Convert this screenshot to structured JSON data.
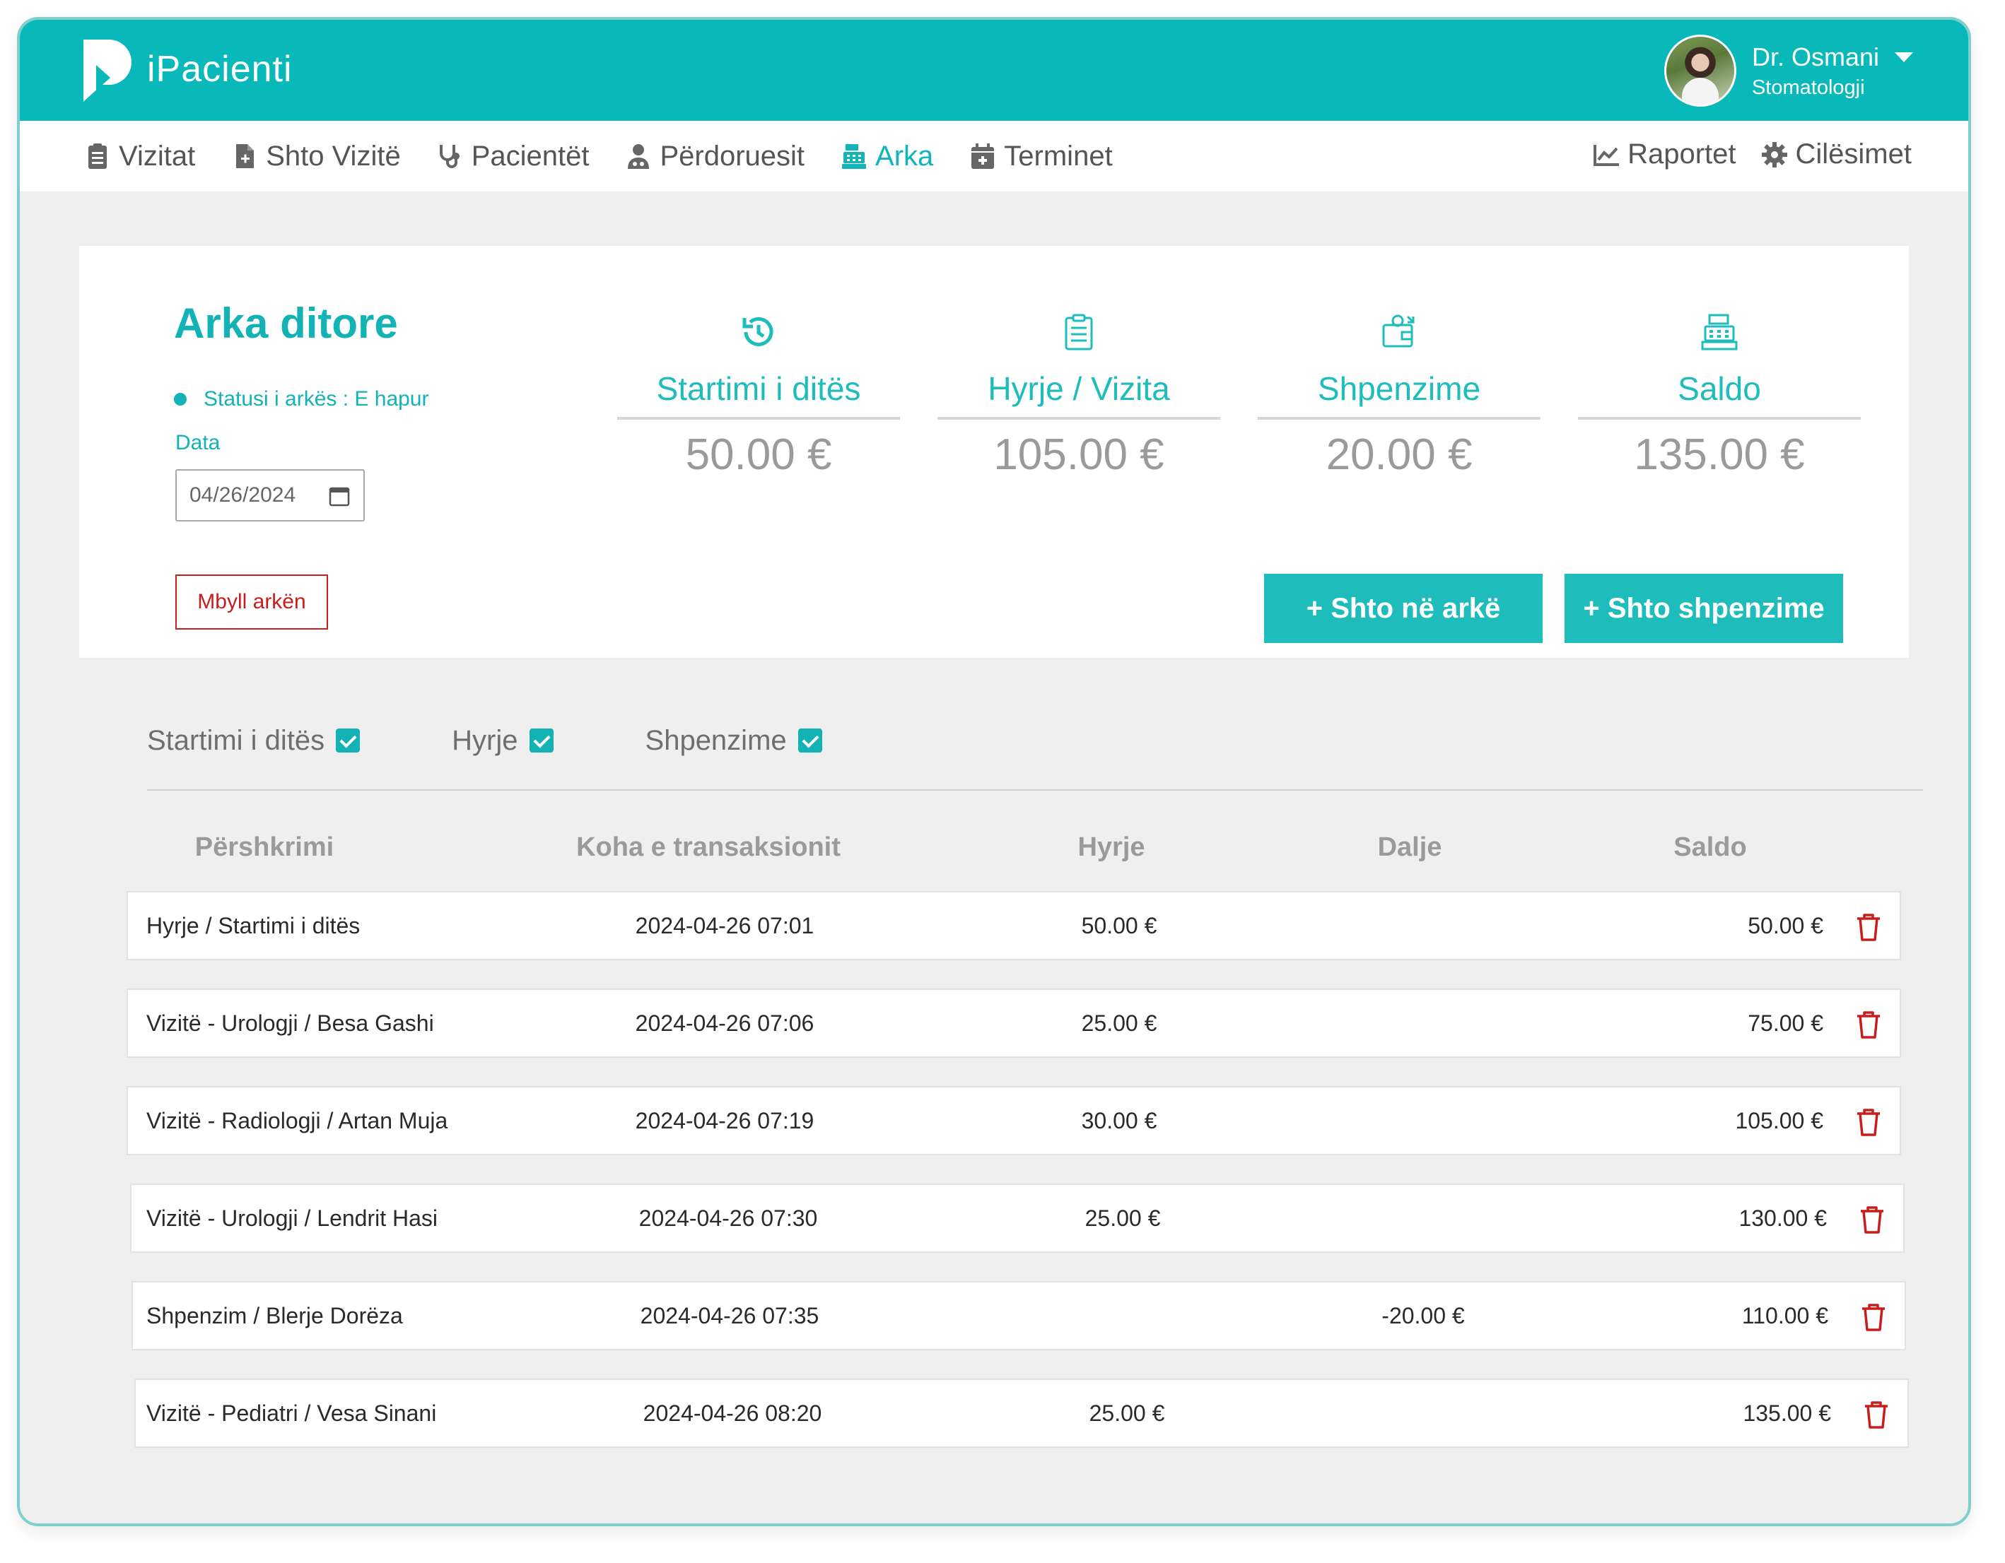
{
  "app": {
    "brand": "iPacienti",
    "accent_color": "#09b8b8",
    "danger_color": "#c81d1d"
  },
  "user": {
    "name": "Dr. Osmani",
    "role": "Stomatologji"
  },
  "nav": {
    "left": [
      {
        "label": "Vizitat",
        "icon": "clipboard-icon",
        "active": false
      },
      {
        "label": "Shto Vizitë",
        "icon": "file-plus-icon",
        "active": false
      },
      {
        "label": "Pacientët",
        "icon": "stethoscope-icon",
        "active": false
      },
      {
        "label": "Përdoruesit",
        "icon": "user-doctor-icon",
        "active": false
      },
      {
        "label": "Arka",
        "icon": "cash-register-icon",
        "active": true
      },
      {
        "label": "Terminet",
        "icon": "calendar-plus-icon",
        "active": false
      }
    ],
    "right": [
      {
        "label": "Raportet",
        "icon": "chart-line-icon"
      },
      {
        "label": "Cilësimet",
        "icon": "gear-icon"
      }
    ]
  },
  "summary": {
    "title": "Arka ditore",
    "status": "Statusi i arkës : E hapur",
    "date_label": "Data",
    "date_value": "04/26/2024",
    "close_button": "Mbyll arkën",
    "stats": [
      {
        "label": "Startimi i ditës",
        "value": "50.00 €",
        "icon": "history-icon"
      },
      {
        "label": "Hyrje / Vizita",
        "value": "105.00 €",
        "icon": "clipboard-list-icon"
      },
      {
        "label": "Shpenzime",
        "value": "20.00 €",
        "icon": "wallet-icon"
      },
      {
        "label": "Saldo",
        "value": "135.00 €",
        "icon": "cash-register-icon"
      }
    ],
    "add_cash_button": "+ Shto në arkë",
    "add_expense_button": "+ Shto shpenzime"
  },
  "filters": [
    {
      "label": "Startimi i ditës",
      "checked": true
    },
    {
      "label": "Hyrje",
      "checked": true
    },
    {
      "label": "Shpenzime",
      "checked": true
    }
  ],
  "table": {
    "headers": [
      "Përshkrimi",
      "Koha e transaksionit",
      "Hyrje",
      "Dalje",
      "Saldo"
    ],
    "rows": [
      {
        "description": "Hyrje / Startimi i ditës",
        "time": "2024-04-26 07:01",
        "in": "50.00 €",
        "out": "",
        "balance": "50.00 €"
      },
      {
        "description": "Vizitë - Urologji / Besa Gashi",
        "time": "2024-04-26 07:06",
        "in": "25.00 €",
        "out": "",
        "balance": "75.00 €"
      },
      {
        "description": "Vizitë - Radiologji / Artan Muja",
        "time": "2024-04-26 07:19",
        "in": "30.00 €",
        "out": "",
        "balance": "105.00 €"
      },
      {
        "description": "Vizitë - Urologji / Lendrit Hasi",
        "time": "2024-04-26 07:30",
        "in": "25.00 €",
        "out": "",
        "balance": "130.00 €"
      },
      {
        "description": "Shpenzim / Blerje Dorëza",
        "time": "2024-04-26 07:35",
        "in": "",
        "out": "-20.00 €",
        "balance": "110.00 €"
      },
      {
        "description": "Vizitë - Pediatri / Vesa Sinani",
        "time": "2024-04-26 08:20",
        "in": "25.00 €",
        "out": "",
        "balance": "135.00 €"
      }
    ]
  }
}
